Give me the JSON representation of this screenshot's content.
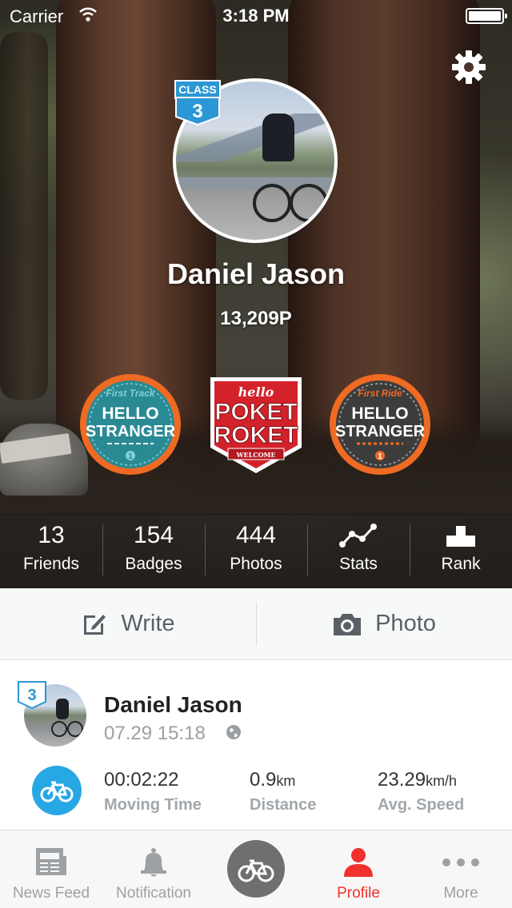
{
  "status_bar": {
    "carrier": "Carrier",
    "time": "3:18 PM"
  },
  "profile": {
    "class_label": "CLASS",
    "class_level": "3",
    "name": "Daniel Jason",
    "points": "13,209P"
  },
  "badges": [
    {
      "subtitle": "First Track",
      "line1": "HELLO",
      "line2": "STRANGER",
      "number": "1",
      "color": "#2a8a93"
    },
    {
      "top": "hello",
      "line1": "POKET",
      "line2": "ROKET",
      "ribbon": "WELCOME",
      "color": "#d3222a"
    },
    {
      "subtitle": "First Ride",
      "line1": "HELLO",
      "line2": "STRANGER",
      "number": "1",
      "color": "#3c3c3c"
    }
  ],
  "stats": [
    {
      "value": "13",
      "label": "Friends"
    },
    {
      "value": "154",
      "label": "Badges"
    },
    {
      "value": "444",
      "label": "Photos"
    },
    {
      "icon": "stats-graph-icon",
      "label": "Stats"
    },
    {
      "icon": "rank-podium-icon",
      "label": "Rank"
    }
  ],
  "actions": {
    "write": "Write",
    "photo": "Photo"
  },
  "post": {
    "class_level": "3",
    "name": "Daniel Jason",
    "time": "07.29 15:18",
    "metrics": [
      {
        "value": "00:02:22",
        "unit": "",
        "label": "Moving Time"
      },
      {
        "value": "0.9",
        "unit": "km",
        "label": "Distance"
      },
      {
        "value": "23.29",
        "unit": "km/h",
        "label": "Avg. Speed"
      }
    ]
  },
  "tabs": [
    {
      "label": "News Feed",
      "icon": "newspaper-icon"
    },
    {
      "label": "Notification",
      "icon": "bell-icon"
    },
    {
      "label": "",
      "icon": "bicycle-icon"
    },
    {
      "label": "Profile",
      "icon": "person-icon",
      "active": true
    },
    {
      "label": "More",
      "icon": "more-dots-icon"
    }
  ],
  "colors": {
    "accent": "#f0302c",
    "ride_blue": "#27a7e3",
    "badge_orange": "#ef6a22"
  }
}
